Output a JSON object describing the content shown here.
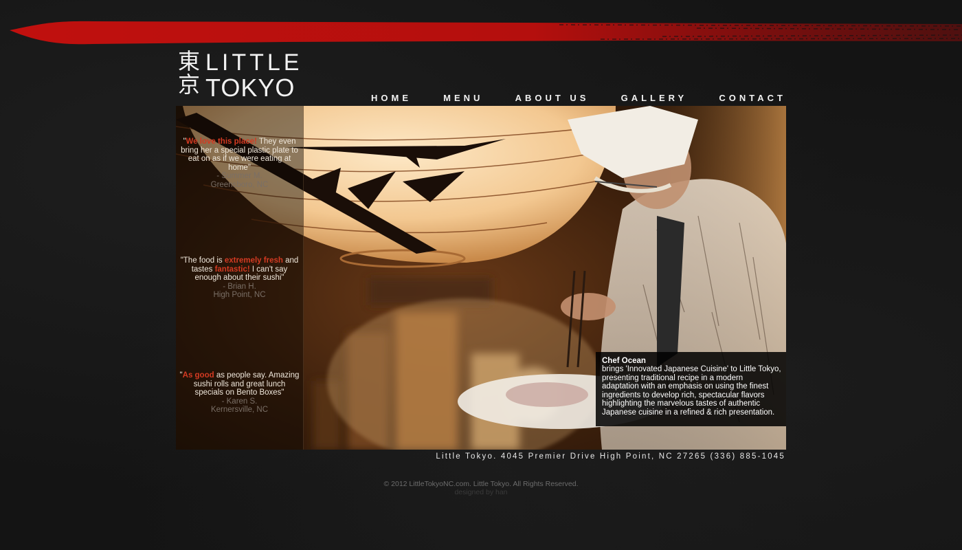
{
  "brand": {
    "kanji_top": "東",
    "kanji_bottom": "京",
    "word_top": "LITTLE",
    "word_bottom": "TOKYO"
  },
  "nav": {
    "items": [
      {
        "label": "HOME"
      },
      {
        "label": "MENU"
      },
      {
        "label": "ABOUT US"
      },
      {
        "label": "GALLERY"
      },
      {
        "label": "CONTACT"
      }
    ]
  },
  "reviews": [
    {
      "open_quote": "\"",
      "highlight": "We love this place!",
      "text": " They even bring her a special plastic plate to eat on as if we were eating at home\"",
      "author": "- Summer M.",
      "location": "Greensboro, NC"
    },
    {
      "prefix": "\"The food is ",
      "highlight1": "extremely fresh",
      "middle": " and tastes ",
      "highlight2": "fantastic!",
      "suffix": "  I can't say enough about their sushi\"",
      "author": "- Brian H.",
      "location": "High Point, NC"
    },
    {
      "open_quote": "\"",
      "highlight": "As good",
      "text": " as people say. Amazing sushi rolls and great lunch specials on Bento Boxes\"",
      "author": "- Karen S.",
      "location": "Kernersville, NC"
    }
  ],
  "chef": {
    "name": "Chef Ocean",
    "description": "brings 'Innovated Japanese Cuisine' to Little Tokyo, presenting traditional recipe in a modern adaptation with an emphasis on using the finest ingredients to develop rich, spectacular flavors highlighting the marvelous tastes of authentic Japanese cuisine in a refined & rich presentation."
  },
  "footer": {
    "address": "Little Tokyo. 4045 Premier Drive High Point, NC 27265 (336) 885-1045",
    "copyright": "© 2012 LittleTokyoNC.com. Little Tokyo. All Rights Reserved.",
    "designed_by": "designed by han"
  },
  "colors": {
    "brush_red": "#b8100e",
    "highlight_red": "#d33a22",
    "background": "#141414"
  }
}
